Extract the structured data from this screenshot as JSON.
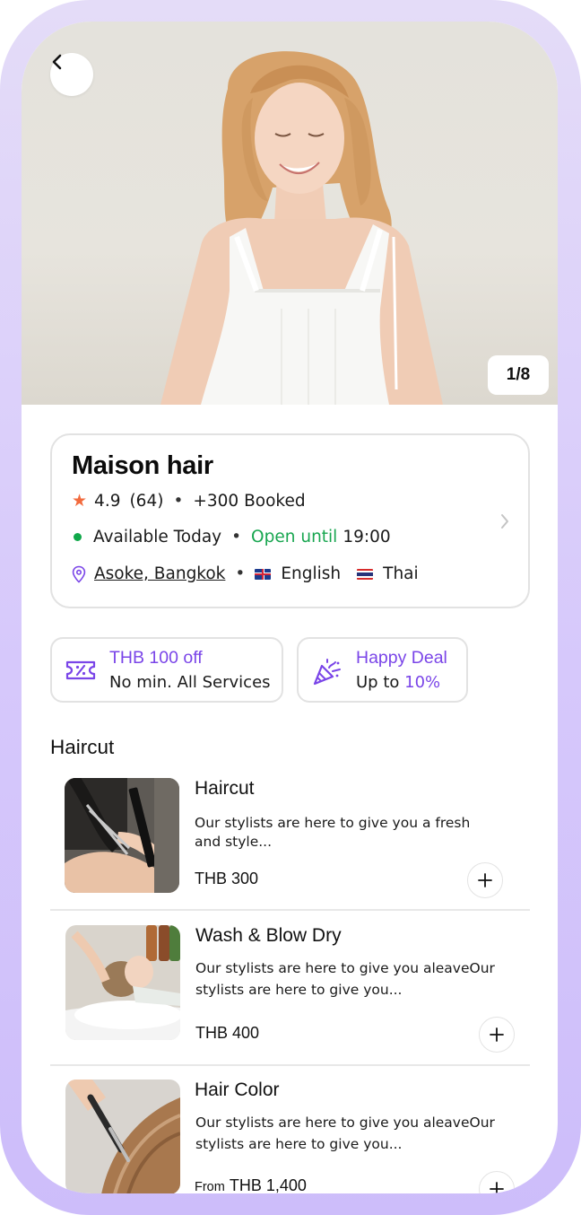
{
  "hero": {
    "image_counter": "1/8"
  },
  "salon": {
    "name": "Maison hair",
    "rating": "4.9",
    "reviews": "(64)",
    "booked": "+300 Booked",
    "availability": "Available Today",
    "open_label": "Open until",
    "open_time": "19:00",
    "location": "Asoke, Bangkok",
    "languages": [
      "English",
      "Thai"
    ]
  },
  "promos": [
    {
      "title": "THB 100 off",
      "subtitle": "No min. All Services",
      "icon": "ticket-discount-icon"
    },
    {
      "title": "Happy Deal",
      "subtitle_prefix": "Up to ",
      "subtitle_accent": "10%",
      "icon": "party-popper-icon"
    }
  ],
  "section": {
    "title": "Haircut"
  },
  "services": [
    {
      "name": "Haircut",
      "description": "Our stylists are here to give you a fresh and style...",
      "price_prefix": "",
      "price": "THB 300"
    },
    {
      "name": "Wash & Blow Dry",
      "description": "Our stylists are here to give you aleaveOur stylists are here to give you...",
      "price_prefix": "",
      "price": "THB 400"
    },
    {
      "name": "Hair Color",
      "description": "Our stylists are here to give you aleaveOur stylists are here to give you...",
      "price_prefix": "From",
      "price": "THB 1,400"
    }
  ],
  "colors": {
    "accent_purple": "#7a45e8",
    "open_green": "#18a650",
    "star_orange": "#f26a3d",
    "frame_lavender": "#d6c8fb"
  }
}
